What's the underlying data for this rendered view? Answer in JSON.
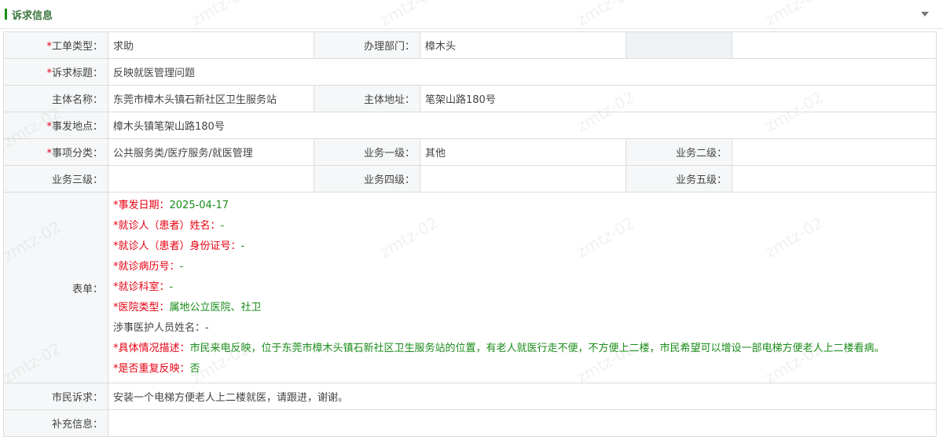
{
  "section": {
    "title": "诉求信息"
  },
  "fields": {
    "ticket_type": {
      "label": "工单类型：",
      "value": "求助"
    },
    "department": {
      "label": "办理部门：",
      "value": "樟木头"
    },
    "title": {
      "label": "诉求标题：",
      "value": "反映就医管理问题"
    },
    "entity_name": {
      "label": "主体名称：",
      "value": "东莞市樟木头镇石新社区卫生服务站"
    },
    "entity_address": {
      "label": "主体地址：",
      "value": "笔架山路180号"
    },
    "incident_location": {
      "label": "事发地点：",
      "value": "樟木头镇笔架山路180号"
    },
    "category": {
      "label": "事项分类：",
      "value": "公共服务类/医疗服务/就医管理"
    },
    "biz_level1": {
      "label": "业务一级：",
      "value": "其他"
    },
    "biz_level2": {
      "label": "业务二级：",
      "value": ""
    },
    "biz_level3": {
      "label": "业务三级：",
      "value": ""
    },
    "biz_level4": {
      "label": "业务四级：",
      "value": ""
    },
    "biz_level5": {
      "label": "业务五级：",
      "value": ""
    },
    "form": {
      "label": "表单：",
      "items": [
        {
          "key": "*事发日期：",
          "value": "2025-04-17"
        },
        {
          "key": "*就诊人（患者）姓名：",
          "value": "-"
        },
        {
          "key": "*就诊人（患者）身份证号：",
          "value": "-"
        },
        {
          "key": "*就诊病历号：",
          "value": "-"
        },
        {
          "key": "*就诊科室：",
          "value": "-"
        },
        {
          "key": "*医院类型：",
          "value": "属地公立医院、社卫"
        },
        {
          "key": "涉事医护人员姓名：",
          "value": "-"
        },
        {
          "key": "*具体情况描述：",
          "value": "市民来电反映，位于东莞市樟木头镇石新社区卫生服务站的位置，有老人就医行走不便，不方便上二楼，市民希望可以增设一部电梯方便老人上二楼看病。"
        },
        {
          "key": "*是否重复反映：",
          "value": "否"
        }
      ]
    },
    "citizen_request": {
      "label": "市民诉求：",
      "value": "安装一个电梯方便老人上二楼就医，请跟进，谢谢。"
    },
    "supplement": {
      "label": "补充信息：",
      "value": ""
    }
  },
  "required_mark": "*",
  "watermark_text": "zmtz-02"
}
